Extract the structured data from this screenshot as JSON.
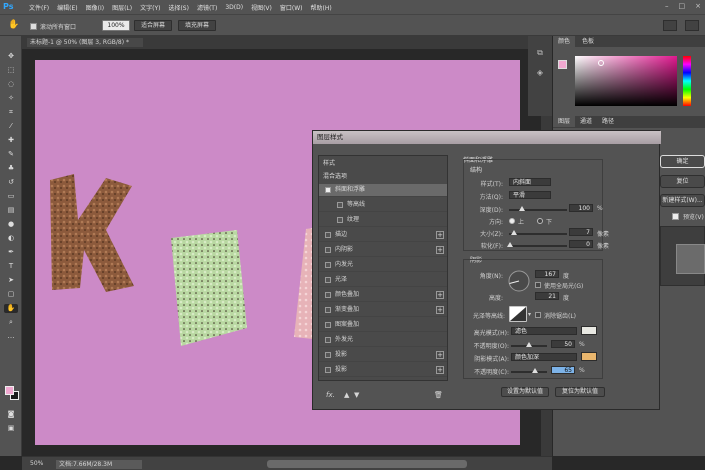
{
  "app": {
    "logo": "Ps",
    "menus": [
      "文件(F)",
      "编辑(E)",
      "图像(I)",
      "图层(L)",
      "文字(Y)",
      "选择(S)",
      "滤镜(T)",
      "3D(D)",
      "视图(V)",
      "窗口(W)",
      "帮助(H)"
    ],
    "window_controls": [
      "–",
      "□",
      "×"
    ]
  },
  "options_bar": {
    "scroll_all_label": "滚动所有窗口",
    "zoom_value": "100%",
    "fit_screen_label": "适合屏幕",
    "fill_screen_label": "填充屏幕"
  },
  "document": {
    "tab_title": "未标题-1 @ 50% (图层 3, RGB/8) *",
    "zoom": "50%",
    "doc_info": "文档:7.66M/28.3M"
  },
  "colors": {
    "canvas_bg": "#cc8ac7",
    "foreground": "#f0a8d0",
    "background": "#1b1b1b",
    "highlight_color": "#e8e8e2",
    "shadow_color": "#e9b66d"
  },
  "panels": {
    "color_tabs": [
      "颜色",
      "色板"
    ],
    "layer_tabs": [
      "图层",
      "通道",
      "路径"
    ]
  },
  "dialog": {
    "title": "图层样式",
    "styles_header": "样式",
    "blend_options": "混合选项",
    "items": [
      {
        "label": "斜面和浮雕",
        "checked": true,
        "selected": true,
        "sub": false,
        "plus": false
      },
      {
        "label": "等高线",
        "checked": false,
        "selected": false,
        "sub": true,
        "plus": false
      },
      {
        "label": "纹理",
        "checked": false,
        "selected": false,
        "sub": true,
        "plus": false
      },
      {
        "label": "描边",
        "checked": false,
        "selected": false,
        "sub": false,
        "plus": true
      },
      {
        "label": "内阴影",
        "checked": false,
        "selected": false,
        "sub": false,
        "plus": true
      },
      {
        "label": "内发光",
        "checked": false,
        "selected": false,
        "sub": false,
        "plus": false
      },
      {
        "label": "光泽",
        "checked": false,
        "selected": false,
        "sub": false,
        "plus": false
      },
      {
        "label": "颜色叠加",
        "checked": false,
        "selected": false,
        "sub": false,
        "plus": true
      },
      {
        "label": "渐变叠加",
        "checked": false,
        "selected": false,
        "sub": false,
        "plus": true
      },
      {
        "label": "图案叠加",
        "checked": false,
        "selected": false,
        "sub": false,
        "plus": false
      },
      {
        "label": "外发光",
        "checked": false,
        "selected": false,
        "sub": false,
        "plus": false
      },
      {
        "label": "投影",
        "checked": false,
        "selected": false,
        "sub": false,
        "plus": true
      },
      {
        "label": "投影",
        "checked": false,
        "selected": false,
        "sub": false,
        "plus": true
      }
    ],
    "fx_label": "fx.",
    "bevel": {
      "group_title": "斜面和浮雕",
      "structure_title": "结构",
      "style_label": "样式(T):",
      "style_value": "内斜面",
      "technique_label": "方法(Q):",
      "technique_value": "平滑",
      "depth_label": "深度(D):",
      "depth_value": "100",
      "depth_unit": "%",
      "direction_label": "方向:",
      "direction_up": "上",
      "direction_down": "下",
      "size_label": "大小(Z):",
      "size_value": "7",
      "size_unit": "像素",
      "soften_label": "软化(F):",
      "soften_value": "0",
      "soften_unit": "像素"
    },
    "shading": {
      "title": "阴影",
      "angle_label": "角度(N):",
      "angle_value": "167",
      "angle_unit": "度",
      "global_light_label": "使用全局光(G)",
      "altitude_label": "高度:",
      "altitude_value": "21",
      "altitude_unit": "度",
      "gloss_label": "光泽等高线:",
      "anti_alias_label": "消除锯齿(L)",
      "highlight_mode_label": "高光模式(H):",
      "highlight_mode_value": "滤色",
      "highlight_opacity_label": "不透明度(O):",
      "highlight_opacity_value": "50",
      "highlight_opacity_unit": "%",
      "shadow_mode_label": "阴影模式(A):",
      "shadow_mode_value": "颜色加深",
      "shadow_opacity_label": "不透明度(C):",
      "shadow_opacity_value": "65",
      "shadow_opacity_unit": "%"
    },
    "make_default": "设置为默认值",
    "reset_default": "复位为默认值",
    "ok": "确定",
    "reset": "复位",
    "new_style": "新建样式(W)...",
    "preview_label": "预览(V)"
  }
}
